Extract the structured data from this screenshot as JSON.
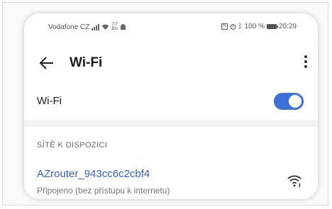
{
  "statusbar": {
    "carrier": "Vodafone CZ",
    "speed_value": "7/7",
    "speed_unit": "B/s",
    "battery": "100 %",
    "time": "20:29"
  },
  "appbar": {
    "title": "Wi-Fi"
  },
  "wifi_toggle": {
    "label": "Wi-Fi",
    "enabled": true,
    "accent_color": "#3e70d9"
  },
  "available": {
    "section_title": "SÍTĚ K DISPOZICI",
    "networks": [
      {
        "name": "AZrouter_943cc6c2cbf4",
        "status": "Připojeno (bez přístupu k internetu)",
        "icon": "wifi-signal-icon"
      }
    ]
  }
}
